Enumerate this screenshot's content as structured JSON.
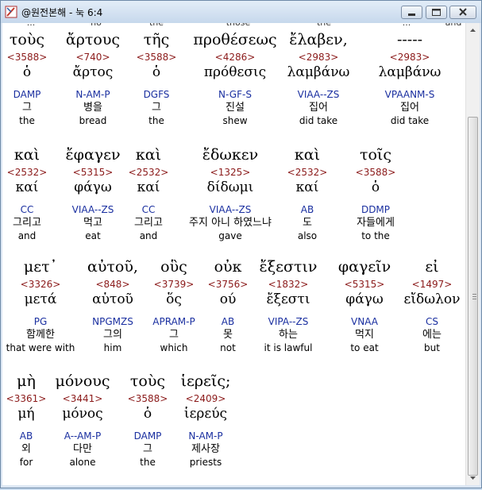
{
  "window": {
    "title": "@원전본해 - 눅 6:4"
  },
  "top_ghost": [
    "...",
    "ho",
    "the",
    "those",
    "the",
    "...",
    "and"
  ],
  "rows": [
    {
      "words": [
        {
          "greek": "τοὺς",
          "strong": "<3588>",
          "lemma": "ὁ",
          "morph": "DAMP",
          "kor": "그",
          "eng": "the"
        },
        {
          "greek": "ἄρτους",
          "strong": "<740>",
          "lemma": "ἄρτος",
          "morph": "N-AM-P",
          "kor": "병을",
          "eng": "bread"
        },
        {
          "greek": "τῆς",
          "strong": "<3588>",
          "lemma": "ὁ",
          "morph": "DGFS",
          "kor": "그",
          "eng": "the"
        },
        {
          "greek": "προθέσεως",
          "strong": "<4286>",
          "lemma": "πρόθεσις",
          "morph": "N-GF-S",
          "kor": "진설",
          "eng": "shew"
        },
        {
          "greek": "ἔλαβεν,",
          "strong": "<2983>",
          "lemma": "λαμβάνω",
          "morph": "VIAA--ZS",
          "kor": "집어",
          "eng": "did take"
        },
        {
          "greek": "-----",
          "strong": "<2983>",
          "lemma": "λαμβάνω",
          "morph": "VPAANM-S",
          "kor": "집어",
          "eng": "did take"
        }
      ]
    },
    {
      "words": [
        {
          "greek": "καὶ",
          "strong": "<2532>",
          "lemma": "καί",
          "morph": "CC",
          "kor": "그리고",
          "eng": "and"
        },
        {
          "greek": "ἔφαγεν",
          "strong": "<5315>",
          "lemma": "φάγω",
          "morph": "VIAA--ZS",
          "kor": "먹고",
          "eng": "eat"
        },
        {
          "greek": "καὶ",
          "strong": "<2532>",
          "lemma": "καί",
          "morph": "CC",
          "kor": "그리고",
          "eng": "and"
        },
        {
          "greek": "ἔδωκεν",
          "strong": "<1325>",
          "lemma": "δίδωμι",
          "morph": "VIAA--ZS",
          "kor": "주지 아니 하였느냐",
          "eng": "gave"
        },
        {
          "greek": "καὶ",
          "strong": "<2532>",
          "lemma": "καί",
          "morph": "AB",
          "kor": "도",
          "eng": "also"
        },
        {
          "greek": "τοῖς",
          "strong": "<3588>",
          "lemma": "ὁ",
          "morph": "DDMP",
          "kor": "자들에게",
          "eng": "to the"
        }
      ]
    },
    {
      "words": [
        {
          "greek": "μετ᾽",
          "strong": "<3326>",
          "lemma": "μετά",
          "morph": "PG",
          "kor": "함께한",
          "eng": "that were with"
        },
        {
          "greek": "αὐτοῦ,",
          "strong": "<848>",
          "lemma": "αὑτοῦ",
          "morph": "NPGMZS",
          "kor": "그의",
          "eng": "him"
        },
        {
          "greek": "οὓς",
          "strong": "<3739>",
          "lemma": "ὅς",
          "morph": "APRAM-P",
          "kor": "그",
          "eng": "which"
        },
        {
          "greek": "οὐκ",
          "strong": "<3756>",
          "lemma": "ού",
          "morph": "AB",
          "kor": "못",
          "eng": "not"
        },
        {
          "greek": "ἔξεστιν",
          "strong": "<1832>",
          "lemma": "ἔξεστι",
          "morph": "VIPA--ZS",
          "kor": "하는",
          "eng": "it is lawful"
        },
        {
          "greek": "φαγεῖν",
          "strong": "<5315>",
          "lemma": "φάγω",
          "morph": "VNAA",
          "kor": "먹지",
          "eng": "to eat"
        },
        {
          "greek": "εἰ",
          "strong": "<1497>",
          "lemma": "εἴδωλον",
          "morph": "CS",
          "kor": "에는",
          "eng": "but"
        }
      ]
    },
    {
      "words": [
        {
          "greek": "μὴ",
          "strong": "<3361>",
          "lemma": "μή",
          "morph": "AB",
          "kor": "외",
          "eng": "for"
        },
        {
          "greek": "μόνους",
          "strong": "<3441>",
          "lemma": "μόνος",
          "morph": "A--AM-P",
          "kor": "다만",
          "eng": "alone"
        },
        {
          "greek": "τοὺς",
          "strong": "<3588>",
          "lemma": "ὁ",
          "morph": "DAMP",
          "kor": "그",
          "eng": "the"
        },
        {
          "greek": "ἱερεῖς;",
          "strong": "<2409>",
          "lemma": "ἱερεύς",
          "morph": "N-AM-P",
          "kor": "제사장",
          "eng": "priests"
        }
      ]
    }
  ]
}
